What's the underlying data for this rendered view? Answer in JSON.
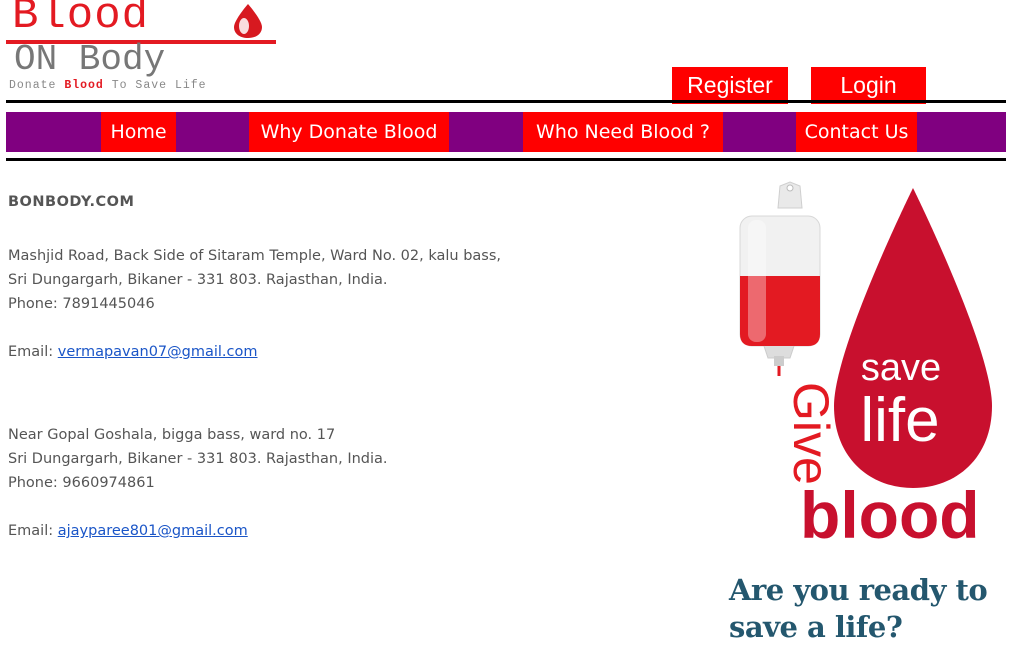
{
  "logo": {
    "title": "Blood",
    "subtitle": "ON Body",
    "tagline_pre": "Donate ",
    "tagline_bold": "Blood",
    "tagline_post": " To Save Life"
  },
  "header": {
    "register_label": "Register",
    "login_label": "Login"
  },
  "nav": {
    "items": [
      {
        "label": "Home"
      },
      {
        "label": "Why Donate Blood"
      },
      {
        "label": "Who Need Blood ?"
      },
      {
        "label": "Contact Us"
      }
    ]
  },
  "contact": {
    "site_name": "BONBODY.COM",
    "address1": {
      "line1": "Mashjid Road, Back Side of Sitaram Temple, Ward No. 02, kalu bass,",
      "line2": "Sri Dungargarh, Bikaner - 331 803. Rajasthan, India.",
      "phone_label": "Phone: ",
      "phone": "7891445046",
      "email_label": "Email: ",
      "email": "vermapavan07@gmail.com"
    },
    "address2": {
      "line1": "Near Gopal Goshala, bigga bass, ward no. 17",
      "line2": "Sri Dungargarh, Bikaner - 331 803. Rajasthan, India.",
      "phone_label": "Phone: ",
      "phone": "9660974861",
      "email_label": "Email: ",
      "email": "ajayparee801@gmail.com"
    }
  },
  "promo": {
    "give": "Give",
    "save": "save",
    "life": "life",
    "blood": "blood",
    "headline_line1": "Are you ready to",
    "headline_line2": "save a life?"
  },
  "colors": {
    "accent_red": "#ff0000",
    "nav_purple": "#800080",
    "headline": "#24576e",
    "blood_red": "#c8102e"
  }
}
